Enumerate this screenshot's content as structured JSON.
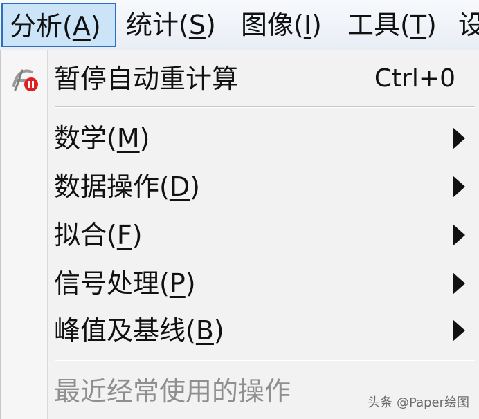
{
  "menubar": {
    "items": [
      {
        "label": "分析(",
        "mnemonic": "A",
        "suffix": ")",
        "active": true
      },
      {
        "label": "统计(",
        "mnemonic": "S",
        "suffix": ")",
        "active": false
      },
      {
        "label": "图像(",
        "mnemonic": "I",
        "suffix": ")",
        "active": false
      },
      {
        "label": "工具(",
        "mnemonic": "T",
        "suffix": ")",
        "active": false
      },
      {
        "label": "设",
        "mnemonic": "",
        "suffix": "",
        "active": false
      }
    ]
  },
  "dropdown": {
    "pause": {
      "label": "暂停自动重计算",
      "shortcut": "Ctrl+0",
      "icon": "pause-recalc-icon"
    },
    "submenus": [
      {
        "label": "数学(",
        "mnemonic": "M",
        "suffix": ")"
      },
      {
        "label": "数据操作(",
        "mnemonic": "D",
        "suffix": ")"
      },
      {
        "label": "拟合(",
        "mnemonic": "F",
        "suffix": ")"
      },
      {
        "label": "信号处理(",
        "mnemonic": "P",
        "suffix": ")"
      },
      {
        "label": "峰值及基线(",
        "mnemonic": "B",
        "suffix": ")"
      }
    ],
    "recent": {
      "label": "最近经常使用的操作",
      "disabled": true
    }
  },
  "watermark": "头条 @Paper绘图",
  "colors": {
    "active_highlight": "#cce4f7",
    "active_border": "#2f6fbf",
    "disabled_text": "#8f8f8f",
    "icon_badge": "#e02020"
  }
}
